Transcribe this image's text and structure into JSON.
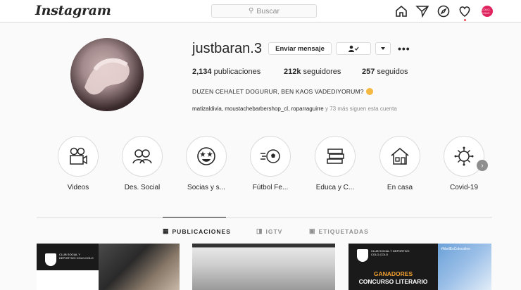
{
  "header": {
    "logo": "Instagram",
    "search_placeholder": "Buscar",
    "icons": [
      "home-icon",
      "direct-icon",
      "explore-icon",
      "activity-heart-icon",
      "profile-avatar-icon"
    ],
    "avatar_text": "COLO-COLO"
  },
  "profile": {
    "username": "justbaran.3",
    "message_button": "Enviar mensaje",
    "follow_button_icon": "person-check-icon",
    "dropdown_icon": "chevron-down-icon",
    "more_icon": "more-horizontal-icon",
    "posts_count": "2,134",
    "posts_label": "publicaciones",
    "followers_count": "212k",
    "followers_label": "seguidores",
    "following_count": "257",
    "following_label": "seguidos",
    "bio": "DUZEN CEHALET DOGURUR, BEN KAOS VADEDIYORUM?",
    "bio_emoji": "zany-face-emoji",
    "followed_by": "matizaldivia, moustachebarbershop_cl, roparraguirre",
    "followed_more": "y 73 más siguen esta cuenta"
  },
  "highlights": [
    {
      "label": "Videos",
      "icon": "film-projector-icon"
    },
    {
      "label": "Des. Social",
      "icon": "two-people-icon"
    },
    {
      "label": "Socias y s...",
      "icon": "star-eyes-emoji-icon"
    },
    {
      "label": "Fútbol Fe...",
      "icon": "soccer-ball-icon"
    },
    {
      "label": "Educa y C...",
      "icon": "books-icon"
    },
    {
      "label": "En casa",
      "icon": "house-icon"
    },
    {
      "label": "Covid-19",
      "icon": "virus-icon"
    }
  ],
  "tabs": [
    {
      "label": "PUBLICACIONES",
      "icon": "grid-icon",
      "active": true
    },
    {
      "label": "IGTV",
      "icon": "tv-icon",
      "active": false
    },
    {
      "label": "ETIQUETADAS",
      "icon": "tag-person-icon",
      "active": false
    }
  ],
  "posts": [
    {
      "text": "CLUB SOCIAL Y DEPORTIVO COLO-COLO"
    },
    {
      "text": ""
    },
    {
      "text": "CLUB SOCIAL Y DEPORTIVO COLO-COLO",
      "title": "GANADORES",
      "subtitle": "CONCURSO LITERARIO",
      "tag": "#AbrilEsColocolino"
    }
  ]
}
